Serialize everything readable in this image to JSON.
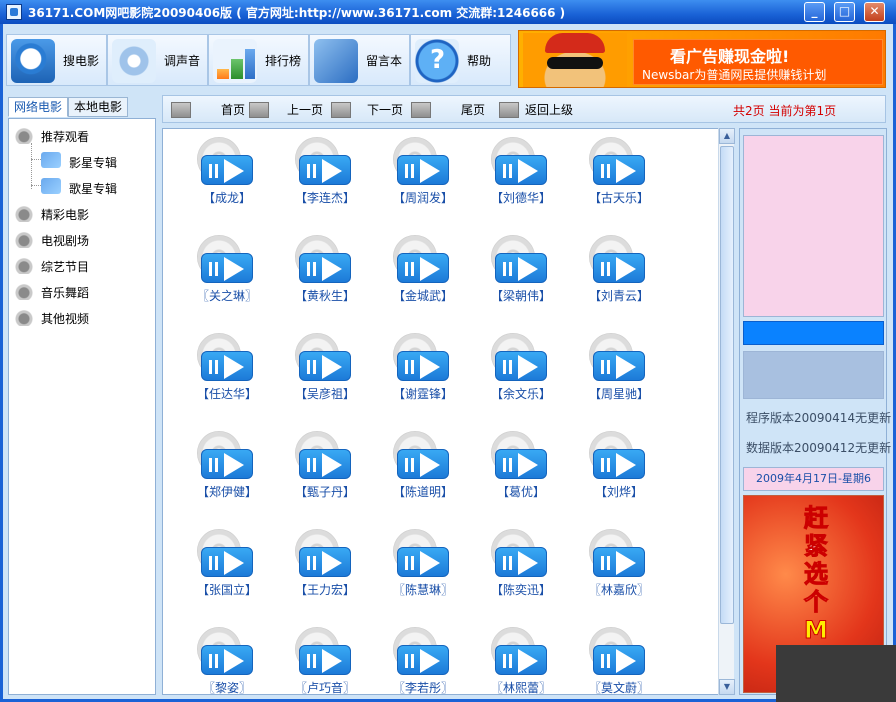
{
  "window": {
    "title": "36171.COM网吧影院20090406版 ( 官方网址:http://www.36171.com 交流群:1246666 )",
    "minimize_label": "_",
    "maximize_label": "□",
    "close_label": "✕"
  },
  "toolbar": [
    {
      "label": "搜电影",
      "icon": "search-icon"
    },
    {
      "label": "调声音",
      "icon": "sound-icon"
    },
    {
      "label": "排行榜",
      "icon": "chart-icon"
    },
    {
      "label": "留言本",
      "icon": "guestbook-icon"
    },
    {
      "label": "帮助",
      "icon": "help-icon"
    }
  ],
  "banner": {
    "headline": "看广告赚现金啦!",
    "subline": "Newsbar为普通网民提供赚钱计划"
  },
  "left_tabs": [
    {
      "label": "网络电影",
      "active": true
    },
    {
      "label": "本地电影",
      "active": false
    }
  ],
  "tree": [
    {
      "label": "推荐观看",
      "level": 0
    },
    {
      "label": "影星专辑",
      "level": 1
    },
    {
      "label": "歌星专辑",
      "level": 1
    },
    {
      "label": "精彩电影",
      "level": 0
    },
    {
      "label": "电视剧场",
      "level": 0
    },
    {
      "label": "综艺节目",
      "level": 0
    },
    {
      "label": "音乐舞蹈",
      "level": 0
    },
    {
      "label": "其他视频",
      "level": 0
    }
  ],
  "nav": {
    "first": "首页",
    "prev": "上一页",
    "next": "下一页",
    "last": "尾页",
    "up": "返回上级",
    "page_info": "共2页  当前为第1页"
  },
  "grid": [
    [
      "【成龙】",
      "【李连杰】",
      "【周润发】",
      "【刘德华】",
      "【古天乐】"
    ],
    [
      "〖关之琳〗",
      "【黄秋生】",
      "【金城武】",
      "【梁朝伟】",
      "【刘青云】"
    ],
    [
      "【任达华】",
      "【吴彦祖】",
      "【谢霆锋】",
      "【余文乐】",
      "【周星驰】"
    ],
    [
      "【郑伊健】",
      "【甄子丹】",
      "【陈道明】",
      "【葛优】",
      "【刘烨】"
    ],
    [
      "【张国立】",
      "【王力宏】",
      "〖陈慧琳〗",
      "【陈奕迅】",
      "〖林嘉欣〗"
    ],
    [
      "〖黎姿〗",
      "〖卢巧音〗",
      "〖李若彤〗",
      "〖林熙蕾〗",
      "〖莫文蔚〗"
    ]
  ],
  "right_panel": {
    "program_version": "程序版本20090414无更新",
    "data_version": "数据版本20090412无更新",
    "date": "2009年4月17日-星期6",
    "ad_text": [
      "赶",
      "紧",
      "选",
      "个",
      "M"
    ]
  },
  "colors": {
    "titlebar": "#1a62d6",
    "accent": "#0a82ff",
    "page_info": "#d40000",
    "item_text": "#1a4fa8"
  }
}
